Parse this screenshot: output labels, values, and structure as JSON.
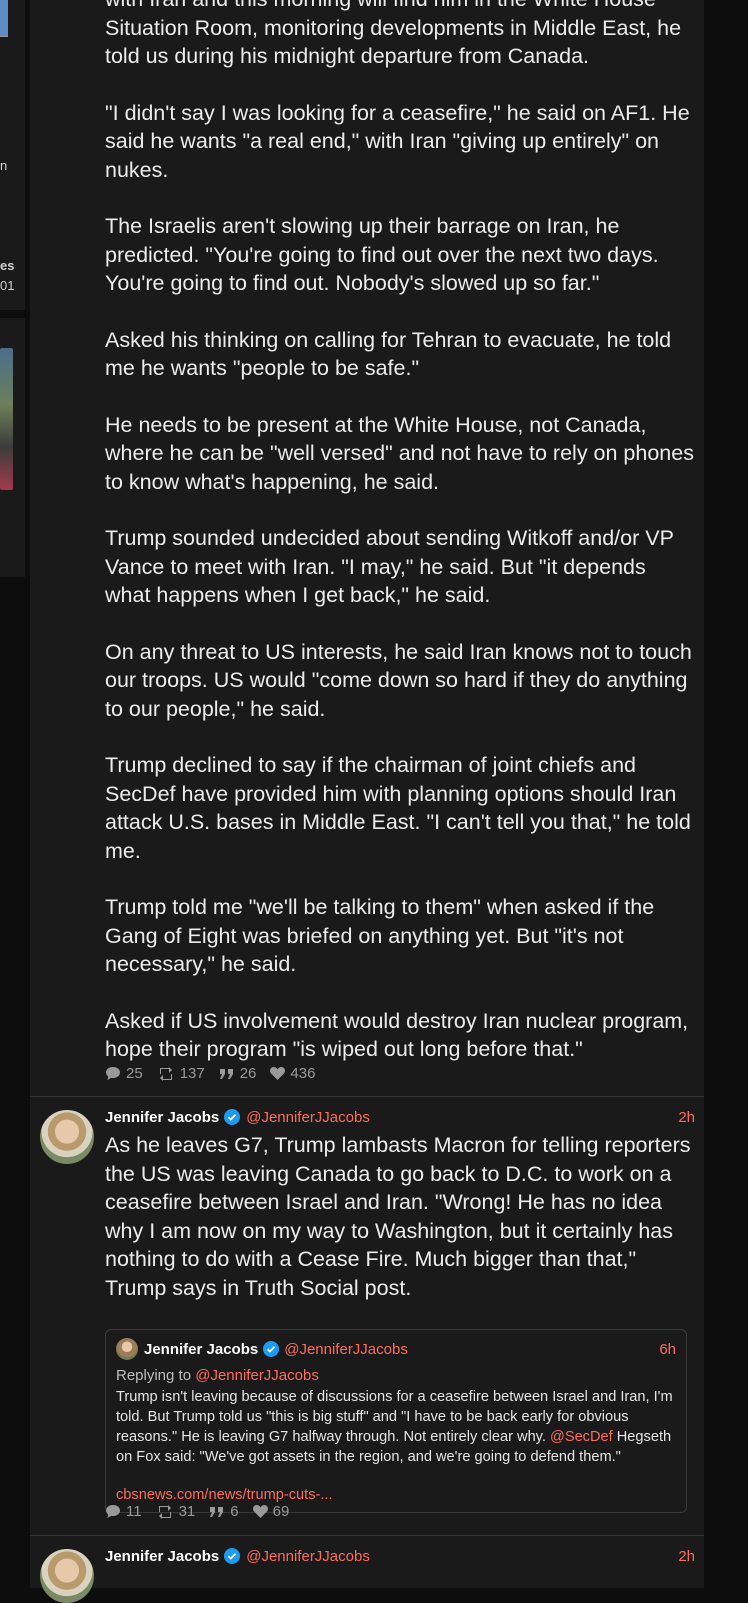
{
  "sidebar_fragments": [
    "n",
    "es",
    "01"
  ],
  "post1": {
    "paragraphs": [
      "with Iran and this morning will find him in the White House Situation Room, monitoring developments in Middle East, he told us during his midnight departure from Canada.",
      "\"I didn't say I was looking for a ceasefire,\" he said on AF1. He said he wants \"a real end,\" with Iran \"giving up entirely\" on nukes.",
      "The Israelis aren't slowing up their barrage on Iran, he predicted. \"You're going to find out over the next two days. You're going to find out. Nobody's slowed up so far.\"",
      "Asked his thinking on calling for Tehran to evacuate, he told me he wants \"people to be safe.\"",
      "He needs to be present at the White House, not Canada, where he can be \"well versed\" and not have to rely on phones to know what's happening, he said.",
      "Trump sounded undecided about sending Witkoff and/or VP Vance to meet with Iran. \"I may,\" he said. But \"it depends what happens when I get back,\" he said.",
      "On any threat to US interests, he said Iran knows not to touch our troops. US would \"come down so hard if they do anything to our people,\" he said.",
      "Trump declined to say if the chairman of joint chiefs and SecDef have provided him with planning options should Iran attack U.S. bases in Middle East. \"I can't tell you that,\" he told me.",
      "Trump told me \"we'll be talking to them\" when asked if the Gang of Eight was briefed on anything yet. But \"it's not necessary,\" he said.",
      "Asked if US involvement would destroy Iran nuclear program, hope their program \"is wiped out long before that.\""
    ],
    "stats": {
      "replies": "25",
      "reblogs": "137",
      "quotes": "26",
      "likes": "436"
    }
  },
  "post2": {
    "author": "Jennifer Jacobs",
    "handle": "@JenniferJJacobs",
    "time": "2h",
    "text": "As he leaves G7, Trump lambasts Macron for telling reporters the US was leaving Canada to go back to D.C. to work on a ceasefire between Israel and Iran. \"Wrong! He has no idea why I am now on my way to Washington, but it certainly has nothing to do with a Cease Fire. Much bigger than that,\" Trump says in Truth Social post.",
    "quote": {
      "author": "Jennifer Jacobs",
      "handle": "@JenniferJJacobs",
      "time": "6h",
      "reply_prefix": "Replying to",
      "reply_handle": "@JenniferJJacobs",
      "body_before": "Trump isn't leaving because of discussions for a ceasefire between Israel and Iran, I'm told. But Trump told us \"this is big stuff\" and \"I have to be back early for obvious reasons.\" He is leaving G7 halfway through. Not entirely clear why. ",
      "mention": "@SecDef",
      "body_after": " Hegseth on Fox said: \"We've got assets in the region, and we're going to defend them.\"",
      "link": "cbsnews.com/news/trump-cuts-..."
    },
    "stats": {
      "replies": "11",
      "reblogs": "31",
      "quotes": "6",
      "likes": "69"
    }
  },
  "post3": {
    "author": "Jennifer Jacobs",
    "handle": "@JenniferJJacobs",
    "time": "2h"
  },
  "colors": {
    "accent": "#ff6b5e",
    "verified": "#1d9bf0",
    "panel": "#1a1a1a",
    "background": "#0d0d0d"
  }
}
